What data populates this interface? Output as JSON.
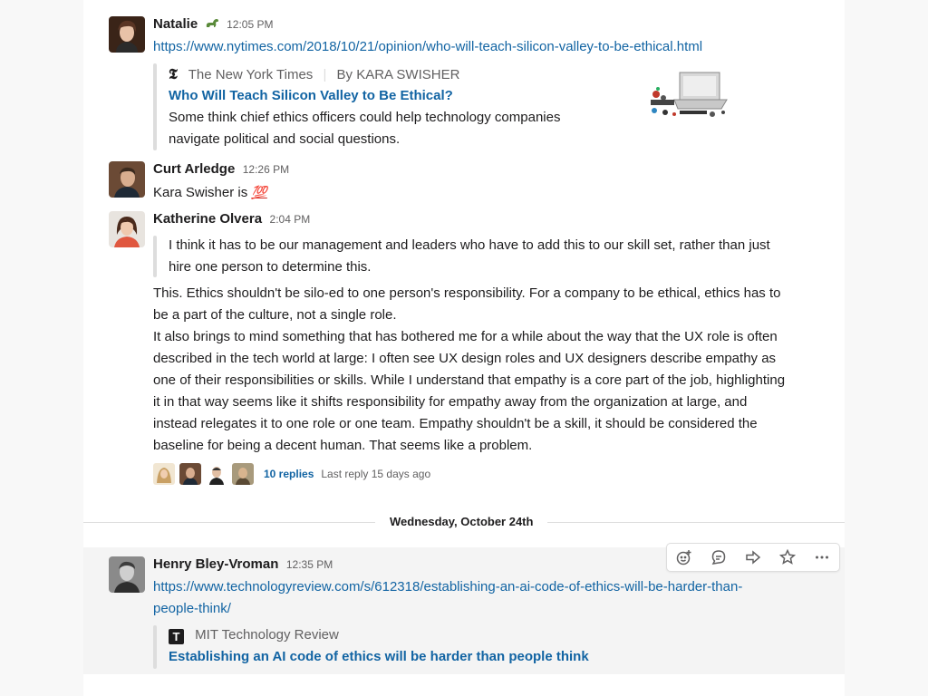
{
  "messages": [
    {
      "author": "Natalie",
      "badge_icon": "dinosaur-emoji",
      "time": "12:05 PM",
      "link": "https://www.nytimes.com/2018/10/21/opinion/who-will-teach-silicon-valley-to-be-ethical.html",
      "attachment": {
        "source": "The New York Times",
        "byline": "By KARA SWISHER",
        "title": "Who Will Teach Silicon Valley to Be Ethical?",
        "description_lines": [
          "Some think chief ethics officers could help technology companies",
          "navigate political and social questions."
        ]
      }
    },
    {
      "author": "Curt Arledge",
      "time": "12:26 PM",
      "text": "Kara Swisher is",
      "emoji": "💯"
    },
    {
      "author": "Katherine Olvera",
      "time": "2:04 PM",
      "quote_lines": [
        "I think it has to be our management and leaders who have to add this to our skill set, rather than just",
        "hire one person to determine this."
      ],
      "body_lines": [
        "This. Ethics shouldn't be silo-ed to one person's responsibility. For a company to be ethical, ethics has to",
        "be a part of the culture, not a single role.",
        "It also brings to mind something that has bothered me for a while about the way that the UX role is often",
        "described in the tech world at large: I often see UX design roles and UX designers describe empathy as",
        "one of their responsibilities or skills. While I understand that empathy is a core part of the job, highlighting",
        "it in that way seems like it shifts responsibility for empathy away from the organization at large, and",
        "instead relegates it to one role or one team. Empathy shouldn't be a skill, it should be considered the",
        "baseline for being a decent human. That seems like a problem."
      ],
      "thread": {
        "replies": "10 replies",
        "last_reply": "Last reply 15 days ago"
      }
    },
    {
      "author": "Henry Bley-Vroman",
      "time": "12:35 PM",
      "link_lines": [
        "https://www.technologyreview.com/s/612318/establishing-an-ai-code-of-ethics-will-be-harder-than-",
        "people-think/"
      ],
      "attachment": {
        "source": "MIT Technology Review",
        "title": "Establishing an AI code of ethics will be harder than people think"
      }
    }
  ],
  "divider": {
    "label": "Wednesday, October 24th"
  },
  "toolbar": {
    "actions": [
      "add-reaction-icon",
      "reply-thread-icon",
      "share-icon",
      "star-icon",
      "more-actions-icon"
    ]
  },
  "colors": {
    "link": "#1264a3",
    "muted": "#616061",
    "text": "#1d1c1d",
    "hover": "#f4f4f4"
  }
}
